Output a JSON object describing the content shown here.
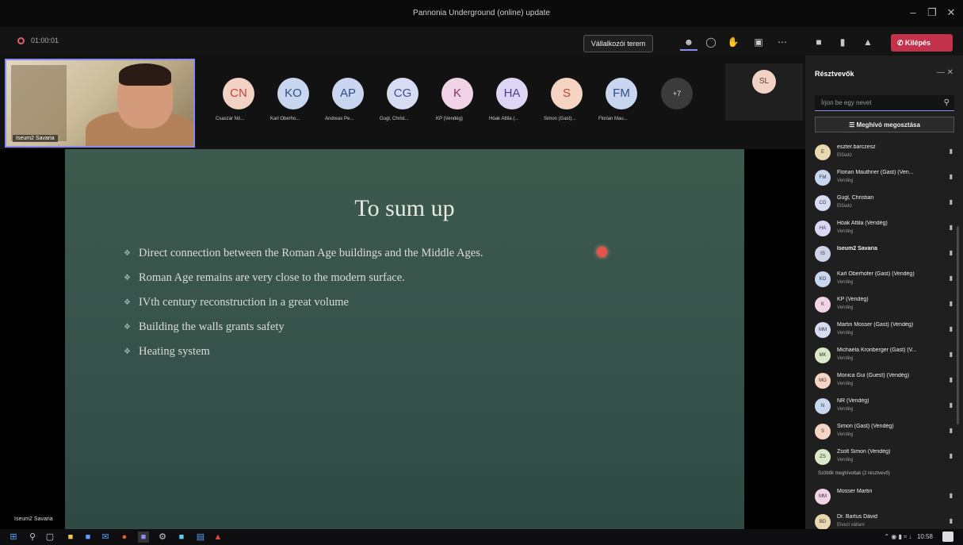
{
  "window": {
    "title": "Pannonia Underground (online) update",
    "minimize": "–",
    "maximize": "❐",
    "close": "✕"
  },
  "toolbar": {
    "timer": "01:00:01",
    "breakout_label": "Vállalkozói terem",
    "leave_label": "Kilépés",
    "icons": [
      "people-icon",
      "chat-icon",
      "hand-icon",
      "rooms-icon",
      "more-icon",
      "camera-icon",
      "mic-icon",
      "share-icon"
    ]
  },
  "video": {
    "self_name": "Iseum2 Savaria",
    "participants": [
      {
        "initials": "CN",
        "name": "Csaszár Nó...",
        "bg": "#f3d2c6",
        "fg": "#c0463b"
      },
      {
        "initials": "KO",
        "name": "Karl Oberho...",
        "bg": "#c9d6ef",
        "fg": "#2f4f8a"
      },
      {
        "initials": "AP",
        "name": "Andreas Pe...",
        "bg": "#c9d6ef",
        "fg": "#2f4f8a"
      },
      {
        "initials": "CG",
        "name": "Gugl, Christ...",
        "bg": "#d7dcf3",
        "fg": "#3f4f8a"
      },
      {
        "initials": "K",
        "name": "KP (Vendég)",
        "bg": "#f1d3e6",
        "fg": "#8a2f6a"
      },
      {
        "initials": "HA",
        "name": "Hóak Attila (...",
        "bg": "#dcd6f4",
        "fg": "#4a3f8a"
      },
      {
        "initials": "S",
        "name": "Simon (Gast)...",
        "bg": "#f5d4c4",
        "fg": "#b0462b"
      },
      {
        "initials": "FM",
        "name": "Florian Mau...",
        "bg": "#c9d6ef",
        "fg": "#2f4f8a"
      }
    ],
    "more_count": "+7",
    "right_tile": "SL"
  },
  "slide": {
    "title": "To sum up",
    "bullets": [
      "Direct connection between the Roman Age buildings and the Middle Ages.",
      "Roman Age remains are very close to the modern surface.",
      "IVth century reconstruction in a great volume",
      "Building the walls grants safety",
      "Heating system"
    ],
    "presenter_label": "Iseum2 Savaria"
  },
  "panel": {
    "title": "Résztvevők",
    "search_placeholder": "Írjon be egy nevet",
    "share_button": "Meghívó megosztása",
    "participants": [
      {
        "name": "eszter.barczesz",
        "role": "Előadó",
        "initials": "E",
        "color": "#e8d9b0"
      },
      {
        "name": "Florian Mauthner (Gast) (Ven...",
        "role": "Vendég",
        "initials": "FM",
        "color": "#c9d6ef"
      },
      {
        "name": "Gugl, Christian",
        "role": "Előadó",
        "initials": "CG",
        "color": "#d7dcf3"
      },
      {
        "name": "Hóak Attila (Vendég)",
        "role": "Vendég",
        "initials": "HA",
        "color": "#dcd6f4"
      },
      {
        "name": "Iseum2 Savaria",
        "role": "",
        "initials": "IS",
        "color": "#cfd3e8"
      },
      {
        "name": "Karl Oberhofer (Gast) (Vendég)",
        "role": "Vendég",
        "initials": "KO",
        "color": "#c9d6ef"
      },
      {
        "name": "KP (Vendég)",
        "role": "Vendég",
        "initials": "K",
        "color": "#f1d3e6"
      },
      {
        "name": "Martin Mosser (Gast) (Vendég)",
        "role": "Vendég",
        "initials": "MM",
        "color": "#d7dcf3"
      },
      {
        "name": "Michaela Kronberger (Gast) (V...",
        "role": "Vendég",
        "initials": "MK",
        "color": "#d9e8c6"
      },
      {
        "name": "Monica Gui (Guest) (Vendég)",
        "role": "Vendég",
        "initials": "MG",
        "color": "#f5d4c4"
      },
      {
        "name": "NR (Vendég)",
        "role": "Vendég",
        "initials": "N",
        "color": "#c9d6ef"
      },
      {
        "name": "Simon (Gast) (Vendég)",
        "role": "Vendég",
        "initials": "S",
        "color": "#f5d4c4"
      },
      {
        "name": "Zsolt Simon (Vendég)",
        "role": "Vendég",
        "initials": "ZS",
        "color": "#d9e8c6"
      }
    ],
    "section_label": "Szöbők meghívottak (2 résztvevő)",
    "invited": [
      {
        "name": "Mosser Martin",
        "role": "",
        "initials": "MM",
        "color": "#f1d3e6"
      },
      {
        "name": "Dr. Bartus Dávid",
        "role": "Elvezi vállani",
        "initials": "BD",
        "color": "#e8d9b0"
      }
    ]
  },
  "taskbar": {
    "tray_time": "10:58"
  }
}
